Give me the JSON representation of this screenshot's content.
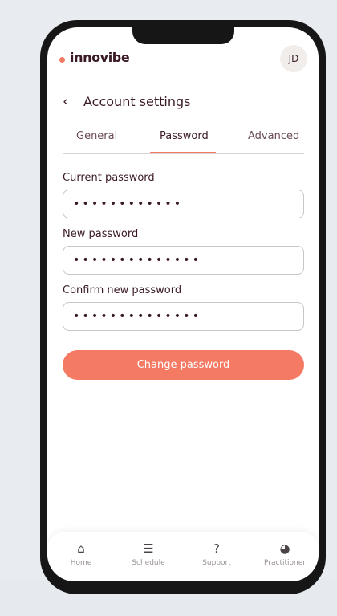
{
  "app": {
    "brand": "innovibe",
    "avatar_initials": "JD",
    "accent_color": "#f47a63"
  },
  "page": {
    "title": "Account settings",
    "back_icon": "chevron-left-icon"
  },
  "tabs": [
    {
      "label": "General",
      "active": false
    },
    {
      "label": "Password",
      "active": true
    },
    {
      "label": "Advanced",
      "active": false
    }
  ],
  "form": {
    "current_password": {
      "label": "Current password",
      "value": "••••••••••••"
    },
    "new_password": {
      "label": "New password",
      "value": "••••••••••••••"
    },
    "confirm_password": {
      "label": "Confirm new password",
      "value": "••••••••••••••"
    },
    "submit_label": "Change password"
  },
  "bottom_nav": [
    {
      "label": "Home",
      "icon": "home-icon",
      "glyph": "⌂"
    },
    {
      "label": "Schedule",
      "icon": "menu-icon",
      "glyph": "☰"
    },
    {
      "label": "Support",
      "icon": "question-icon",
      "glyph": "?"
    },
    {
      "label": "Practitioner",
      "icon": "pie-icon",
      "glyph": "◕"
    }
  ]
}
